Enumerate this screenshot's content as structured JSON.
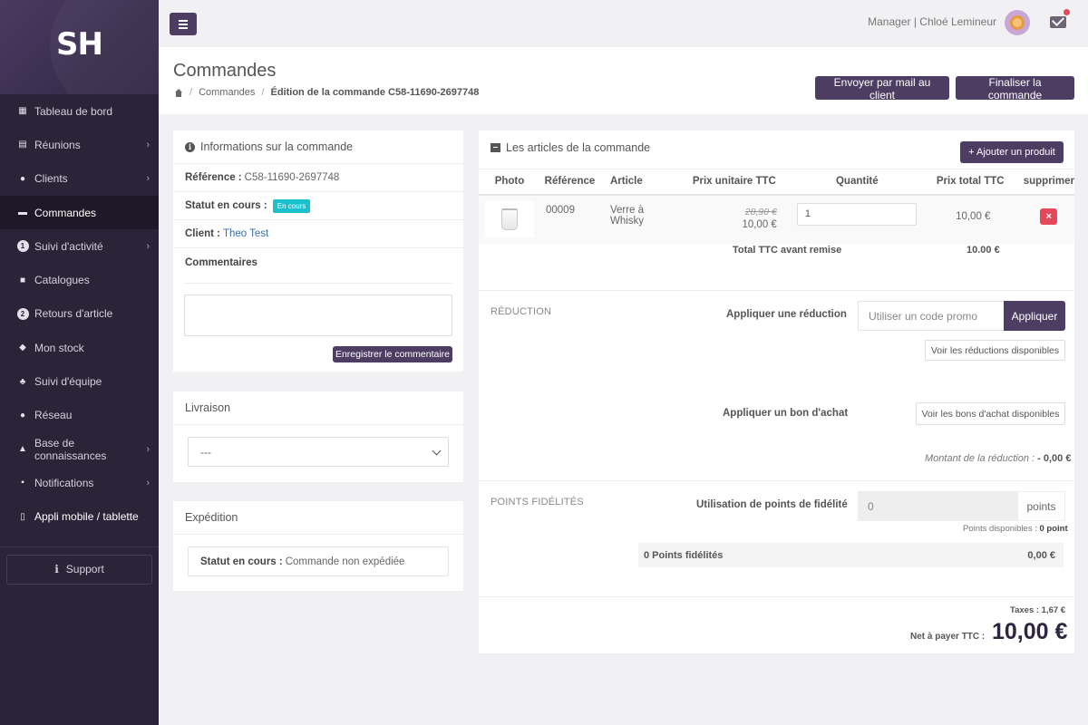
{
  "sidebar": {
    "logo": "SH",
    "items": [
      {
        "label": "Tableau de bord",
        "icon": "dashboard-icon",
        "chevron": false
      },
      {
        "label": "Réunions",
        "icon": "calendar-icon",
        "chevron": true
      },
      {
        "label": "Clients",
        "icon": "users-icon",
        "chevron": true
      },
      {
        "label": "Commandes",
        "icon": "credit-card-icon",
        "chevron": false,
        "active": true
      },
      {
        "label": "Suivi d'activité",
        "icon": "badge-1",
        "badge": "1",
        "chevron": true
      },
      {
        "label": "Catalogues",
        "icon": "book-icon",
        "chevron": false
      },
      {
        "label": "Retours d'article",
        "icon": "badge-2",
        "badge": "2",
        "chevron": false
      },
      {
        "label": "Mon stock",
        "icon": "cube-icon",
        "chevron": false
      },
      {
        "label": "Suivi d'équipe",
        "icon": "sitemap-icon",
        "chevron": false
      },
      {
        "label": "Réseau",
        "icon": "globe-icon",
        "chevron": false
      },
      {
        "label": "Base de connaissances",
        "icon": "graduation-cap-icon",
        "chevron": true
      },
      {
        "label": "Notifications",
        "icon": "bell-icon",
        "chevron": true
      },
      {
        "label": "Appli mobile / tablette",
        "icon": "mobile-icon",
        "chevron": false
      }
    ],
    "support_label": "Support"
  },
  "topbar": {
    "user": "Manager | Chloé Lemineur"
  },
  "header": {
    "title": "Commandes",
    "breadcrumb_parent": "Commandes",
    "breadcrumb_current": "Édition de la commande C58-11690-2697748",
    "btn_email": "Envoyer par mail au client",
    "btn_finalize": "Finaliser la commande"
  },
  "info_card": {
    "title": "Informations sur la commande",
    "ref_label": "Référence :",
    "ref_value": "C58-11690-2697748",
    "status_label": "Statut en cours :",
    "status_badge": "En cours",
    "client_label": "Client :",
    "client_value": "Theo Test",
    "comments_label": "Commentaires",
    "save_comment": "Enregistrer le commentaire"
  },
  "delivery_card": {
    "title": "Livraison",
    "selected": "---"
  },
  "shipping_card": {
    "title": "Expédition",
    "status_label": "Statut en cours :",
    "status_value": "Commande non expédiée"
  },
  "articles_card": {
    "title": "Les articles de la commande",
    "add_button": "Ajouter un produit",
    "columns": [
      "Photo",
      "Référence",
      "Article",
      "Prix unitaire TTC",
      "Quantité",
      "Prix total TTC",
      "supprimer"
    ],
    "rows": [
      {
        "reference": "00009",
        "article": "Verre à Whisky",
        "old_price": "28,90 €",
        "price": "10,00 €",
        "quantity": "1",
        "total": "10,00 €"
      }
    ],
    "total_label": "Total TTC avant remise",
    "total_value": "10.00 €",
    "reduction": {
      "section": "RÉDUCTION",
      "apply_label": "Appliquer une réduction",
      "promo_placeholder": "Utiliser un code promo",
      "apply_button": "Appliquer",
      "see_reductions": "Voir les réductions disponibles",
      "voucher_label": "Appliquer un bon d'achat",
      "see_vouchers": "Voir les bons d'achat disponibles",
      "amount_label": "Montant de la réduction :",
      "amount_value": "- 0,00 €"
    },
    "loyalty": {
      "section": "POINTS FIDÉLITÉS",
      "use_label": "Utilisation de points de fidélité",
      "points_value": "0",
      "points_unit": "points",
      "available_label": "Points disponibles :",
      "available_value": "0 point",
      "bar_label": "0 Points fidélités",
      "bar_value": "0,00 €"
    },
    "taxes_label": "Taxes : 1,67 €",
    "net_label": "Net à payer TTC :",
    "net_value": "10,00 €"
  }
}
